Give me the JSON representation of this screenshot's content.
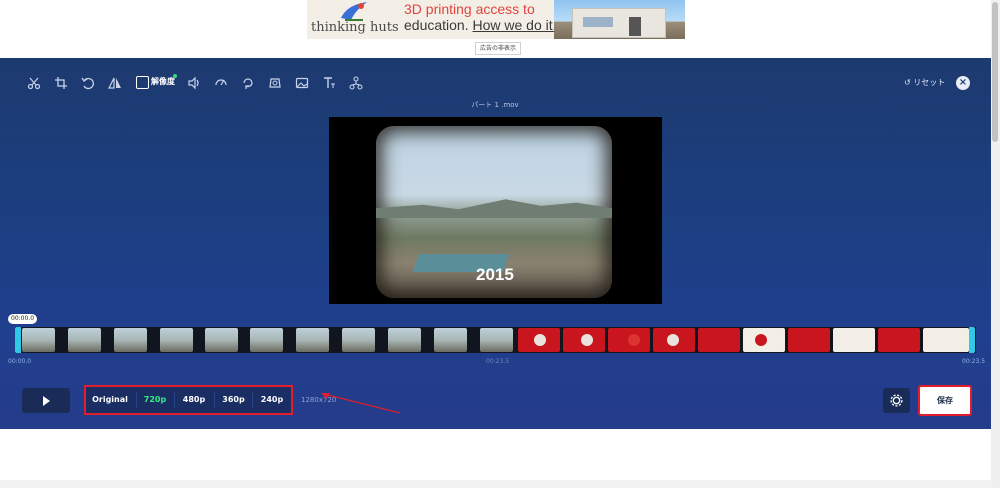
{
  "ad": {
    "logo": "thinking huts",
    "headline_line1": "3D printing access to",
    "headline_line2_a": "education. ",
    "headline_line2_b": "How we do it.",
    "caption": "広告の非表示"
  },
  "toolbar": {
    "icons": [
      "scissors-icon",
      "crop-icon",
      "rotate-icon",
      "flip-icon",
      "resolution-icon",
      "volume-icon",
      "speed-icon",
      "loop-icon",
      "stabilize-icon",
      "image-icon",
      "text-icon",
      "merge-icon"
    ],
    "resolution_label": "解像度",
    "reset_label": "リセット",
    "close_symbol": "×"
  },
  "video": {
    "filename": "パート 1 .mov",
    "year_overlay": "2015"
  },
  "timeline": {
    "current_time_badge": "00:00.0",
    "start_time": "00:00.0",
    "mid_time": "00:23.5",
    "end_time": "00:23.5"
  },
  "resolution_options": [
    {
      "label": "Original",
      "active": false
    },
    {
      "label": "720p",
      "active": true
    },
    {
      "label": "480p",
      "active": false
    },
    {
      "label": "360p",
      "active": false
    },
    {
      "label": "240p",
      "active": false
    }
  ],
  "dimensions": "1280x720",
  "save_label": "保存",
  "colors": {
    "accent_green": "#37e887",
    "highlight_red": "#e21d2c",
    "editor_bg": "#1c3f82",
    "trim_handle": "#2fc9e8"
  }
}
